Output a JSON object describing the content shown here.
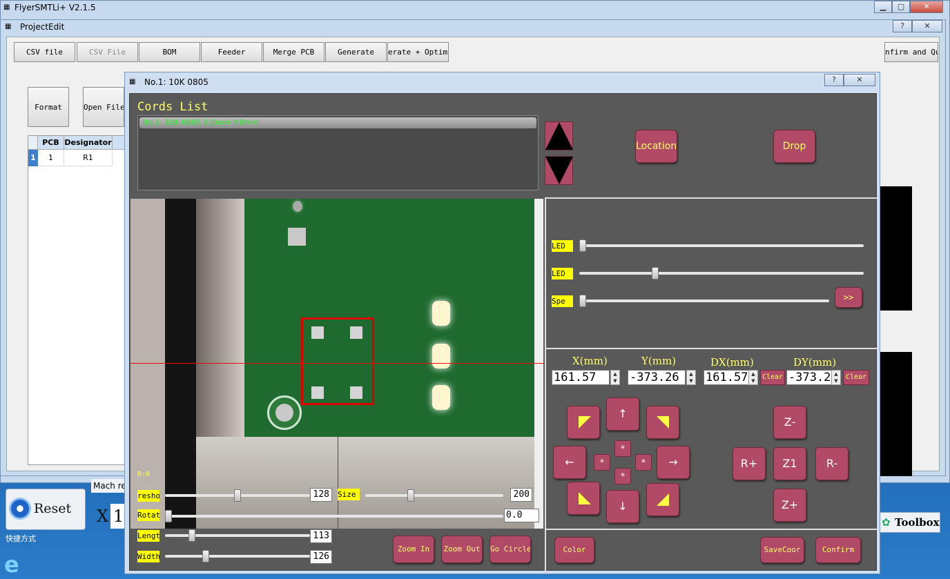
{
  "main_window": {
    "title": "FlyerSMTLi+ V2.1.5"
  },
  "project_edit": {
    "title": "ProjectEdit",
    "toolbar": [
      "CSV file",
      "CSV File",
      "BOM",
      "Feeder",
      "Merge PCB",
      "Generate",
      "erate + Optimi",
      "nfirm and Qu"
    ],
    "format_label": "Format",
    "open_file_label": "Open File",
    "table": {
      "headers": [
        "PCB",
        "Designator"
      ],
      "row_index": "1",
      "rows": [
        [
          "1",
          "R1"
        ]
      ]
    },
    "help_label": "?",
    "close_label": "✕"
  },
  "dialog": {
    "title": "No.1: 10K  0805",
    "help_label": "?",
    "close_label": "✕",
    "cords_list_title": "Cords List",
    "cords_list_items": [
      "No.1: 10K 0805  X:0mm Y:0mm"
    ],
    "location_label": "Location",
    "drop_label": "Drop",
    "sliders": [
      {
        "label": "LED",
        "value": 0
      },
      {
        "label": "LED",
        "value": 0.26
      },
      {
        "label": "Spe",
        "value": 0
      }
    ],
    "forward_label": ">>",
    "coords": {
      "x_label": "X(mm)",
      "x_value": "161.57",
      "y_label": "Y(mm)",
      "y_value": "-373.26",
      "dx_label": "DX(mm)",
      "dx_value": "161.57",
      "dy_label": "DY(mm)",
      "dy_value": "-373.2",
      "clear_label": "Clear"
    },
    "jog": {
      "up": "↑",
      "down": "↓",
      "left": "←",
      "right": "→",
      "step": "*"
    },
    "z_minus": "Z-",
    "z1": "Z1",
    "z_plus": "Z+",
    "r_plus": "R+",
    "r_minus": "R-",
    "camera": {
      "overlay_label": "R:0",
      "threshold_label": "reshol",
      "threshold_value": "128",
      "threshold_level": 0.5,
      "size_label": "Size",
      "size_value": "200",
      "size_level": 0.32,
      "rotate_label": "Rotate",
      "rotate_value": "0.0",
      "length_label": "Length",
      "length_value": "113",
      "length_level": 0.17,
      "width_label": "Width",
      "width_value": "126",
      "width_level": 0.27
    },
    "zoom_in_label": "Zoom In",
    "zoom_out_label": "Zoom Out",
    "go_circle_label": "Go Circle",
    "color_label": "Color",
    "savecoor_label": "SaveCoor",
    "confirm_label": "Confirm"
  },
  "bottom": {
    "reset_label": "Reset",
    "mach_label": "Mach res",
    "x_label": "X",
    "x_value": "1",
    "toolbox_label": "Toolbox",
    "desktop_label": "快捷方式"
  },
  "colors": {
    "accent_button": "#b04a66",
    "yellow_text": "#ffff66",
    "tag_yellow": "#ffff00",
    "dark_panel": "#595959",
    "crosshair": "#ff0000"
  }
}
